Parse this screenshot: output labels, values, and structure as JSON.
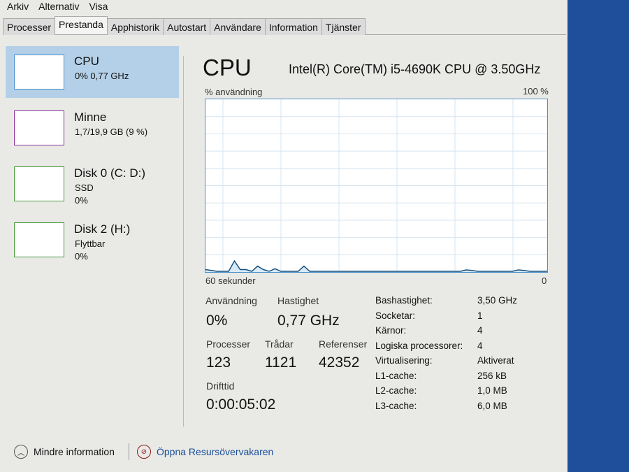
{
  "menu": [
    "Arkiv",
    "Alternativ",
    "Visa"
  ],
  "tabs": [
    "Processer",
    "Prestanda",
    "Apphistorik",
    "Autostart",
    "Användare",
    "Information",
    "Tjänster"
  ],
  "active_tab": "Prestanda",
  "sidebar": [
    {
      "name": "CPU",
      "sub1": "0% 0,77 GHz",
      "color": "#4a8fc8"
    },
    {
      "name": "Minne",
      "sub1": "1,7/19,9 GB (9 %)",
      "color": "#8b2f9e"
    },
    {
      "name": "Disk 0 (C: D:)",
      "sub1": "SSD",
      "sub2": "0%",
      "color": "#4c9a3c"
    },
    {
      "name": "Disk 2 (H:)",
      "sub1": "Flyttbar",
      "sub2": "0%",
      "color": "#4c9a3c"
    }
  ],
  "main": {
    "title": "CPU",
    "model": "Intel(R) Core(TM) i5-4690K CPU @ 3.50GHz",
    "y_label": "% användning",
    "y_max": "100 %",
    "x_left": "60 sekunder",
    "x_right": "0",
    "history": [
      1,
      0.5,
      0,
      0,
      0,
      6,
      1,
      1,
      0,
      3,
      1,
      0,
      1.5,
      0,
      0,
      0,
      0,
      3,
      0,
      0,
      0,
      0,
      0,
      0,
      0,
      0,
      0,
      0,
      0,
      0,
      0,
      0,
      0,
      0,
      0,
      0,
      0,
      0,
      0,
      0,
      0,
      0,
      0,
      0,
      0,
      0.8,
      0.5,
      0,
      0,
      0,
      0,
      0,
      0,
      0,
      0.8,
      0.5,
      0,
      0,
      0,
      0
    ],
    "stats": {
      "usage_label": "Användning",
      "usage": "0%",
      "speed_label": "Hastighet",
      "speed": "0,77 GHz",
      "proc_label": "Processer",
      "proc": "123",
      "threads_label": "Trådar",
      "threads": "1121",
      "handles_label": "Referenser",
      "handles": "42352",
      "uptime_label": "Drifttid",
      "uptime": "0:00:05:02"
    },
    "specs": [
      [
        "Bashastighet:",
        "3,50 GHz"
      ],
      [
        "Socketar:",
        "1"
      ],
      [
        "Kärnor:",
        "4"
      ],
      [
        "Logiska processorer:",
        "4"
      ],
      [
        "Virtualisering:",
        "Aktiverat"
      ],
      [
        "L1-cache:",
        "256 kB"
      ],
      [
        "L2-cache:",
        "1,0 MB"
      ],
      [
        "L3-cache:",
        "6,0 MB"
      ]
    ]
  },
  "footer": {
    "less": "Mindre information",
    "monitor": "Öppna Resursövervakaren"
  }
}
